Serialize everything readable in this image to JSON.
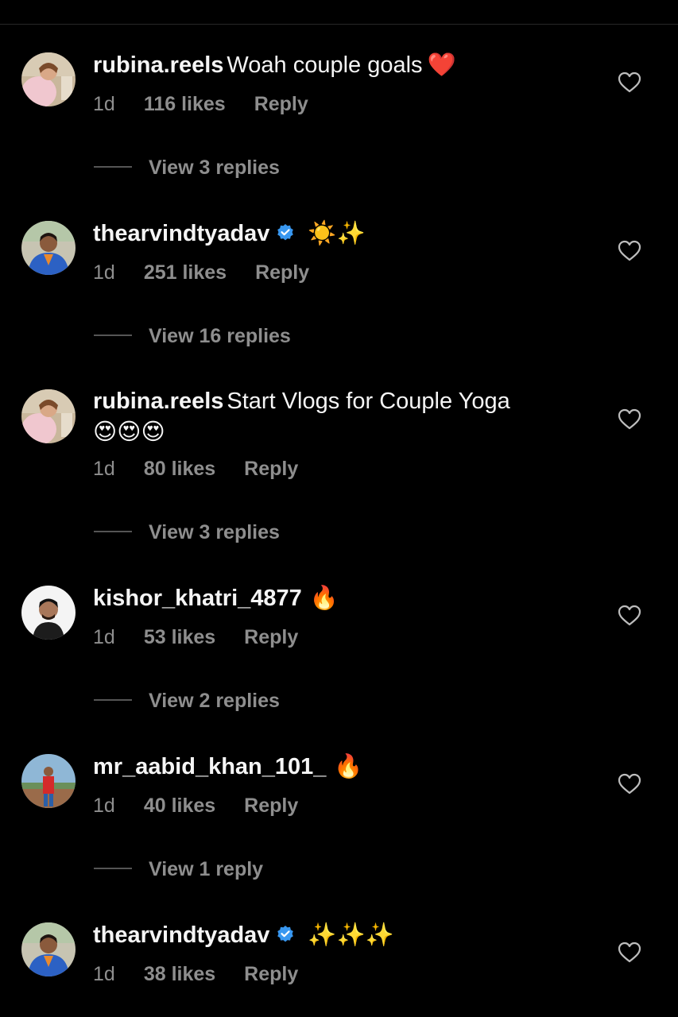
{
  "comments": [
    {
      "username": "rubina.reels",
      "verified": false,
      "text": "Woah couple goals",
      "emoji": "❤️",
      "time": "1d",
      "likes": "116 likes",
      "reply": "Reply",
      "view_replies": "View 3 replies",
      "avatar": "avatar-woman-photo"
    },
    {
      "username": "thearvindtyadav",
      "verified": true,
      "text": "",
      "emoji": "☀️✨",
      "time": "1d",
      "likes": "251 likes",
      "reply": "Reply",
      "view_replies": "View 16 replies",
      "avatar": "avatar-man-photo"
    },
    {
      "username": "rubina.reels",
      "verified": false,
      "text": "Start Vlogs for Couple Yoga",
      "emoji": "😍😍😍",
      "time": "1d",
      "likes": "80 likes",
      "reply": "Reply",
      "view_replies": "View 3 replies",
      "avatar": "avatar-woman-photo"
    },
    {
      "username": "kishor_khatri_4877",
      "verified": false,
      "text": "",
      "emoji": "🔥",
      "time": "1d",
      "likes": "53 likes",
      "reply": "Reply",
      "view_replies": "View 2 replies",
      "avatar": "avatar-man-white-bg"
    },
    {
      "username": "mr_aabid_khan_101_",
      "verified": false,
      "text": "",
      "emoji": "🔥",
      "time": "1d",
      "likes": "40 likes",
      "reply": "Reply",
      "view_replies": "View 1 reply",
      "avatar": "avatar-man-red-shirt"
    },
    {
      "username": "thearvindtyadav",
      "verified": true,
      "text": "",
      "emoji": "✨✨✨",
      "time": "1d",
      "likes": "38 likes",
      "reply": "Reply",
      "view_replies": "",
      "avatar": "avatar-man-photo"
    }
  ],
  "colors": {
    "background": "#000000",
    "text": "#f5f5f5",
    "secondary": "#8e8e8e",
    "verified": "#3897f0"
  },
  "icons": {
    "like": "heart-outline-icon",
    "verified": "verified-badge-icon"
  }
}
